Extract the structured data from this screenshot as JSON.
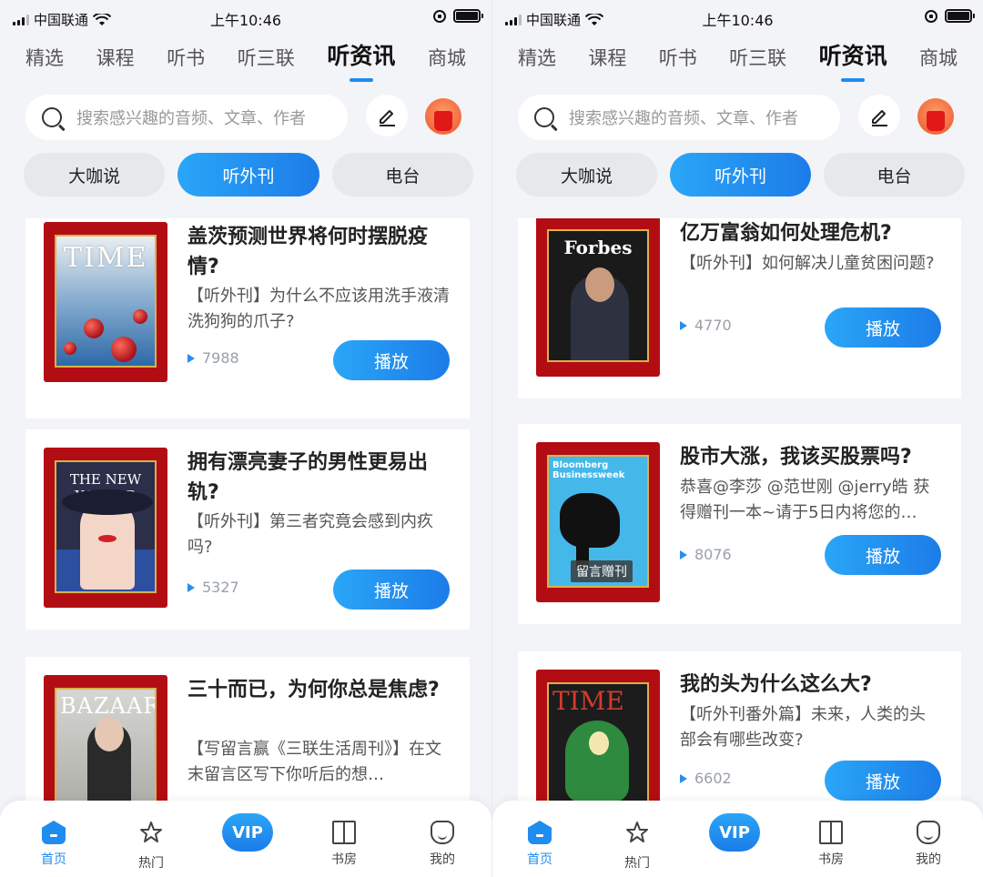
{
  "status": {
    "carrier": "中国联通",
    "time": "上午10:46"
  },
  "top_tabs": [
    "精选",
    "课程",
    "听书",
    "听三联",
    "听资讯",
    "商城"
  ],
  "active_top_tab": "听资讯",
  "search": {
    "placeholder": "搜索感兴趣的音频、文章、作者"
  },
  "sub_tabs": [
    "大咖说",
    "听外刊",
    "电台"
  ],
  "active_sub_tab": "听外刊",
  "play_label": "播放",
  "left_list": [
    {
      "title": "盖茨预测世界将何时摆脱疫情?",
      "desc": "【听外刊】为什么不应该用洗手液清洗狗狗的爪子?",
      "plays": "7988",
      "cover": "time",
      "cover_title": "TIME"
    },
    {
      "title": "拥有漂亮妻子的男性更易出轨?",
      "desc": "【听外刊】第三者究竟会感到内疚吗?",
      "plays": "5327",
      "cover": "newyorker",
      "cover_title": "THE NEW YORKER"
    },
    {
      "title": "三十而已，为何你总是焦虑?",
      "desc": "【写留言赢《三联生活周刊》】在文末留言区写下你听后的想…",
      "plays": "",
      "cover": "bazaar",
      "cover_title": "BAZAAR"
    }
  ],
  "right_list": [
    {
      "title": "亿万富翁如何处理危机?",
      "desc": "【听外刊】如何解决儿童贫困问题?",
      "plays": "4770",
      "cover": "forbes",
      "cover_title": "Forbes"
    },
    {
      "title": "股市大涨，我该买股票吗?",
      "desc": "恭喜@李莎 @范世刚 @jerry皓 获得赠刊一本~请于5日内将您的…",
      "plays": "8076",
      "cover": "bloomberg",
      "cover_title": "Bloomberg Businessweek",
      "cover_badge": "留言赠刊"
    },
    {
      "title": "我的头为什么这么大?",
      "desc": "【听外刊番外篇】未来，人类的头部会有哪些改变?",
      "plays": "6602",
      "cover": "time2",
      "cover_title": "TIME"
    }
  ],
  "bottom_nav": {
    "home": "首页",
    "hot": "热门",
    "vip": "VIP",
    "library": "书房",
    "me": "我的"
  },
  "colors": {
    "accent": "#1f8cf0",
    "cover_frame": "#b30d14"
  }
}
